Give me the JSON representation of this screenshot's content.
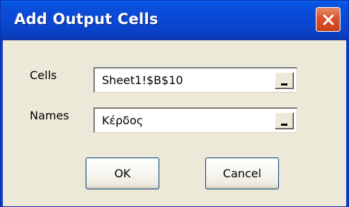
{
  "dialog": {
    "title": "Add Output Cells",
    "close_icon": "close-icon",
    "colors": {
      "titlebar": "#0a47d0",
      "close_button": "#d9542b",
      "client_bg": "#ece9d8"
    }
  },
  "fields": {
    "cells": {
      "label": "Cells",
      "value": "Sheet1!$B$10",
      "ref_icon": "range-select-icon"
    },
    "names": {
      "label": "Names",
      "value": "Κέρδος",
      "ref_icon": "range-select-icon"
    }
  },
  "buttons": {
    "ok": "OK",
    "cancel": "Cancel"
  }
}
